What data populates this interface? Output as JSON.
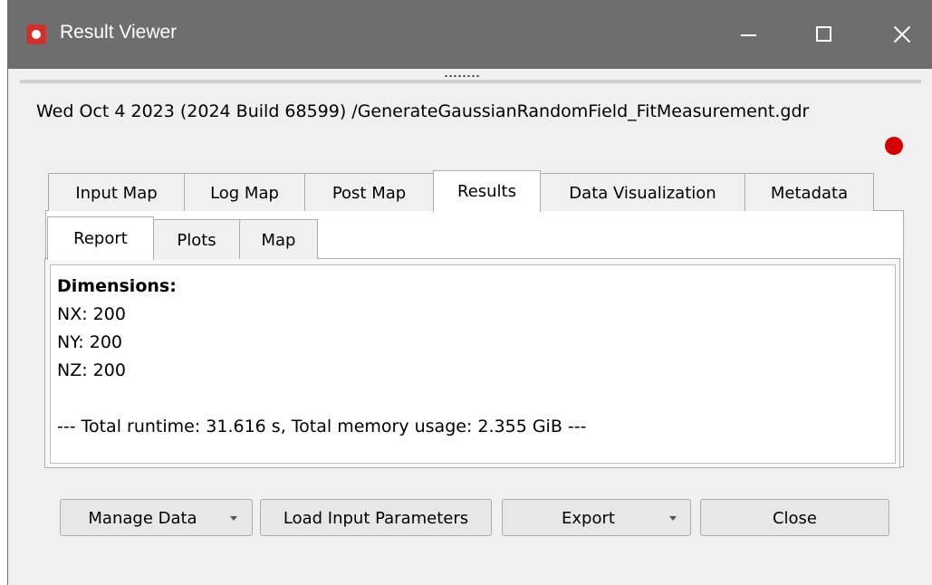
{
  "window": {
    "title": "Result Viewer",
    "path_label": "Wed Oct 4 2023 (2024 Build 68599) /GenerateGaussianRandomField_FitMeasurement.gdr",
    "status_color": "#d40000"
  },
  "tabs": [
    {
      "label": "Input Map",
      "active": false
    },
    {
      "label": "Log Map",
      "active": false
    },
    {
      "label": "Post Map",
      "active": false
    },
    {
      "label": "Results",
      "active": true
    },
    {
      "label": "Data Visualization",
      "active": false
    },
    {
      "label": "Metadata",
      "active": false
    }
  ],
  "subtabs": [
    {
      "label": "Report",
      "active": true
    },
    {
      "label": "Plots",
      "active": false
    },
    {
      "label": "Map",
      "active": false
    }
  ],
  "report": {
    "heading": "Dimensions:",
    "lines": [
      "NX: 200",
      "NY: 200",
      "NZ: 200",
      "",
      "--- Total runtime: 31.616 s, Total memory usage: 2.355 GiB ---"
    ]
  },
  "buttons": {
    "manage_data": "Manage Data",
    "load_input": "Load Input Parameters",
    "export": "Export",
    "close": "Close"
  },
  "icons": [
    "app-icon",
    "minimize-icon",
    "maximize-icon",
    "close-icon",
    "dropdown-arrow-icon"
  ]
}
